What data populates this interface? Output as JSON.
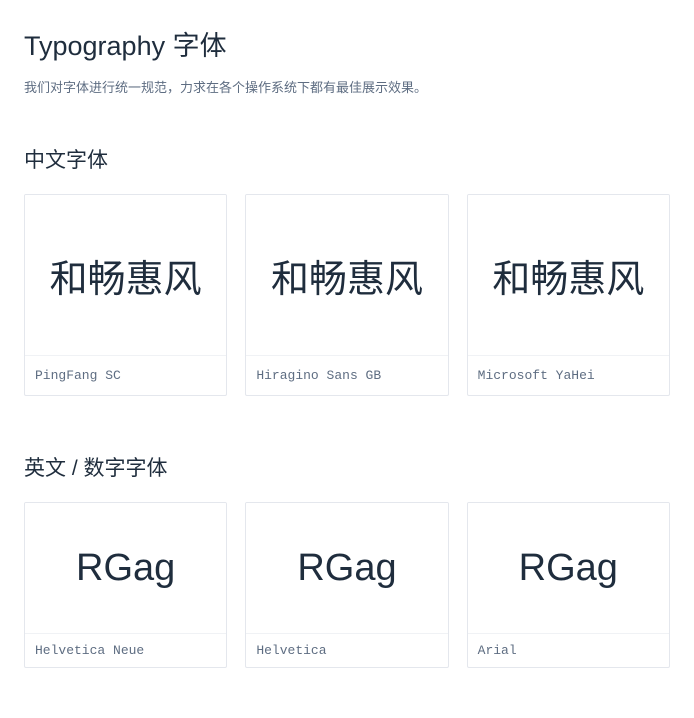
{
  "page": {
    "title": "Typography 字体",
    "description": "我们对字体进行统一规范，力求在各个操作系统下都有最佳展示效果。"
  },
  "sections": {
    "chinese": {
      "title": "中文字体",
      "sample_text": "和畅惠风",
      "fonts": [
        {
          "name": "PingFang SC"
        },
        {
          "name": "Hiragino Sans GB"
        },
        {
          "name": "Microsoft YaHei"
        }
      ]
    },
    "english": {
      "title": "英文 / 数字字体",
      "sample_text": "RGag",
      "fonts": [
        {
          "name": "Helvetica Neue"
        },
        {
          "name": "Helvetica"
        },
        {
          "name": "Arial"
        }
      ]
    }
  }
}
